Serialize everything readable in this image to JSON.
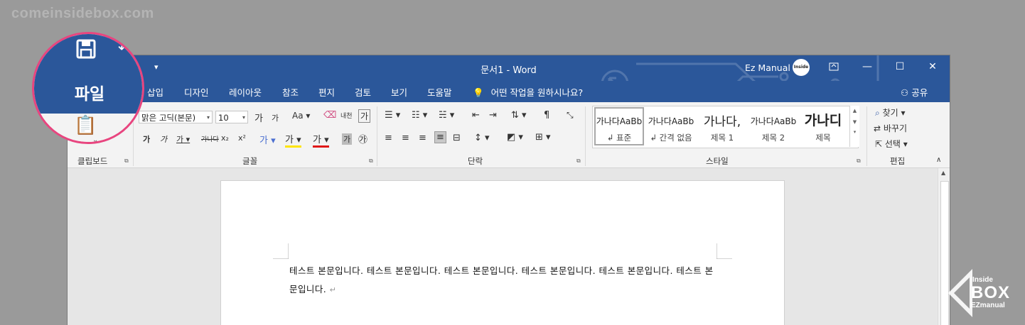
{
  "watermark": "comeinsidebox.com",
  "titlebar": {
    "title": "문서1  -  Word",
    "user": "Ez Manual",
    "avatar_text": "Inside Box"
  },
  "tabs": [
    "파일",
    "삽입",
    "디자인",
    "레이아웃",
    "참조",
    "편지",
    "검토",
    "보기",
    "도움말"
  ],
  "tell_me": "어떤 작업을 원하시나요?",
  "share_label": "공유",
  "ribbon": {
    "font_name": "맑은 고딕(본문)",
    "font_size": "10",
    "groups": [
      "클립보드",
      "글꼴",
      "단락",
      "스타일",
      "편집"
    ],
    "font_buttons_row1": [
      "가",
      "가",
      "Aa",
      "내천",
      "가"
    ],
    "font_buttons_row2": [
      "가",
      "가",
      "가",
      "가나다",
      "x₂",
      "x²",
      "가",
      "가",
      "가",
      "가"
    ],
    "styles": [
      {
        "preview": "가나다AaBb",
        "name": "↲ 표준"
      },
      {
        "preview": "가나다AaBb",
        "name": "↲ 간격 없음"
      },
      {
        "preview": "가나다,",
        "name": "제목 1"
      },
      {
        "preview": "가나다AaBb",
        "name": "제목 2"
      },
      {
        "preview": "가나디",
        "name": "제목"
      }
    ],
    "edit": {
      "find": "찾기",
      "replace": "바꾸기",
      "select": "선택"
    }
  },
  "document": {
    "body": "테스트 본문입니다. 테스트 본문입니다. 테스트 본문입니다. 테스트 본문입니다. 테스트 본문입니다. 테스트 본문입니다.",
    "pilcrow": "↵"
  },
  "magnifier": {
    "file_label": "파일"
  },
  "logo": {
    "line1": "Inside",
    "line2": "BOX",
    "line3": "EZmanual"
  },
  "colors": {
    "word_blue": "#2b579a",
    "highlight_ring": "#e8457f"
  }
}
